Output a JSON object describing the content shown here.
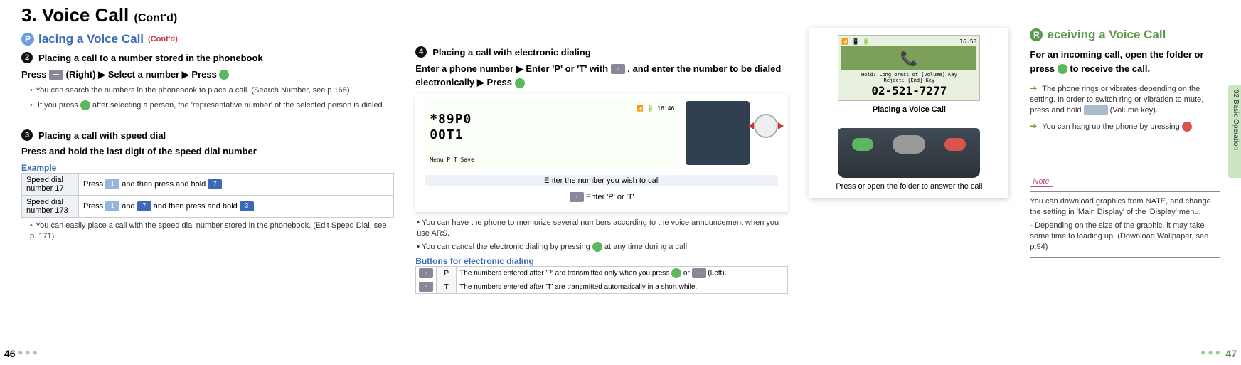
{
  "page": {
    "title_prefix": "3.",
    "title": "Voice Call",
    "title_suffix": "(Cont'd)",
    "left_num": "46",
    "right_num": "47",
    "side_tab": "02  Basic Operation"
  },
  "left": {
    "section_badge": "P",
    "section_title": "lacing a Voice Call",
    "section_suffix": "(Cont'd)",
    "item2": {
      "num": "2",
      "head": "Placing a call to a number stored in the phonebook",
      "instr_a": "Press",
      "instr_b": "(Right)  ▶  Select a number ▶  Press",
      "note1": "You can search the numbers in the phonebook to place a call. (Search Number, see p.168)",
      "note2_a": "If you press",
      "note2_b": "after selecting a person, the 'representative number' of the selected person is dialed."
    },
    "item3": {
      "num": "3",
      "head": "Placing a call with speed dial",
      "instr": "Press and hold the last digit of the speed dial number",
      "example_label": "Example",
      "row1_lab": "Speed dial number 17",
      "row1_a": "Press",
      "row1_b": "and then press and hold",
      "row2_lab": "Speed dial number 173",
      "row2_a": "Press",
      "row2_b": "and",
      "row2_c": "and then press and hold",
      "foot": "You can easily place a call with the speed dial number stored in the phonebook. (Edit Speed Dial, see p. 171)"
    },
    "item4": {
      "num": "4",
      "head": "Placing a call with electronic dialing",
      "instr_a": "Enter a phone number  ▶  Enter 'P' or 'T' with",
      "instr_b": ", and enter the number to be dialed electronically ▶  Press",
      "screen_time": "16:46",
      "screen_text": "*89P0\n00T1",
      "screen_menu": "Menu   P    T    Save",
      "callout1": "Enter the number you wish to call",
      "callout2": "Enter 'P' or 'T'",
      "bullet1": "You can have the phone to memorize several numbers according to the voice announcement when you use ARS.",
      "bullet2_a": "You can cancel the electronic dialing by pressing",
      "bullet2_b": "at any time during a call.",
      "btns_head": "Buttons for electronic dialing",
      "btns_p_key": "P",
      "btns_p_txt": "The numbers entered after 'P' are transmitted only when you press",
      "btns_p_txt2": "or",
      "btns_p_txt3": "(Left).",
      "btns_t_key": "T",
      "btns_t_txt": "The numbers entered after 'T' are transmitted automatically in a short while."
    }
  },
  "mid": {
    "screen_time": "16:50",
    "screen_hint": "Hold: Long press of [Volume] Key\nReject: [End] Key",
    "screen_num": "02-521-7277",
    "cap1": "Placing a Voice Call",
    "cap2": "Press or open the folder to answer the call"
  },
  "right": {
    "badge": "R",
    "title": "eceiving a Voice Call",
    "head_a": "For an incoming call, open the folder or press",
    "head_b": "to receive the call.",
    "b1_a": "The phone rings or vibrates depending on the setting. In order to switch ring or vibration to mute, press and hold",
    "b1_b": "(Volume key).",
    "b2_a": "You can hang up the phone by pressing",
    "b2_b": ".",
    "note_label": "Note",
    "note1": "You can download graphics from NATE, and change the setting in 'Main Display' of the 'Display' menu.",
    "note2": "- Depending on the size of the graphic, it may take some time to loading up. (Download Wallpaper, see p.94)"
  }
}
